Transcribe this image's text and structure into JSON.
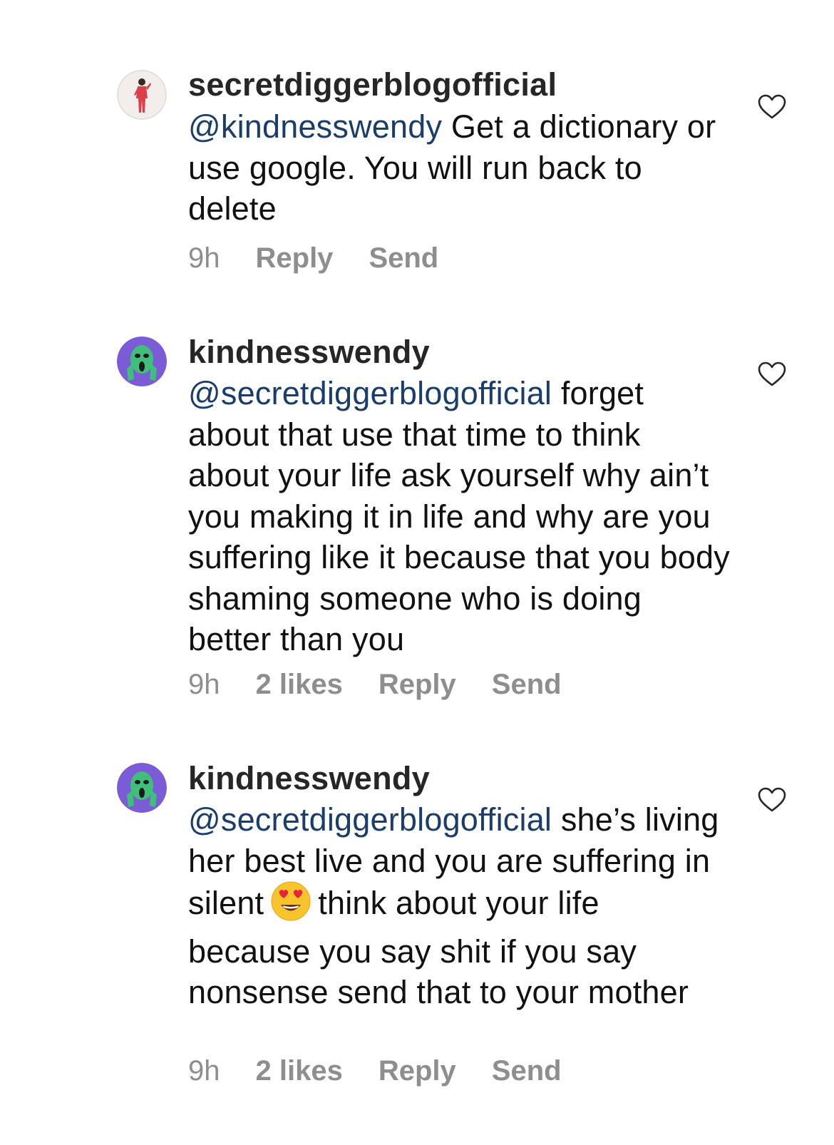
{
  "comments": [
    {
      "username": "secretdiggerblogofficial",
      "mention": "@kindnesswendy",
      "text": "Get a dictionary or use google. You will run back to delete",
      "time": "9h",
      "likes": "",
      "reply_label": "Reply",
      "send_label": "Send",
      "avatar": "woman-in-red-outfit"
    },
    {
      "username": "kindnesswendy",
      "mention": "@secretdiggerblogofficial",
      "text": "forget about that use that time to think about your life ask yourself why ain’t you making it in life and why are you suffering like it because that you body shaming someone who is doing better than you",
      "time": "9h",
      "likes": "2 likes",
      "reply_label": "Reply",
      "send_label": "Send",
      "avatar": "green-mask-purple-background"
    },
    {
      "username": "kindnesswendy",
      "mention": "@secretdiggerblogofficial",
      "text_before_emoji": "she’s living her best live and you are suffering in silent",
      "emoji": "heart-eyes-emoji",
      "text_after_emoji": "think about your life because you say shit if you say nonsense send that to your mother",
      "time": "9h",
      "likes": "2 likes",
      "reply_label": "Reply",
      "send_label": "Send",
      "avatar": "green-mask-purple-background"
    }
  ],
  "colors": {
    "mention": "#1a3d6b",
    "meta": "#8e8e8e",
    "text": "#111111"
  }
}
